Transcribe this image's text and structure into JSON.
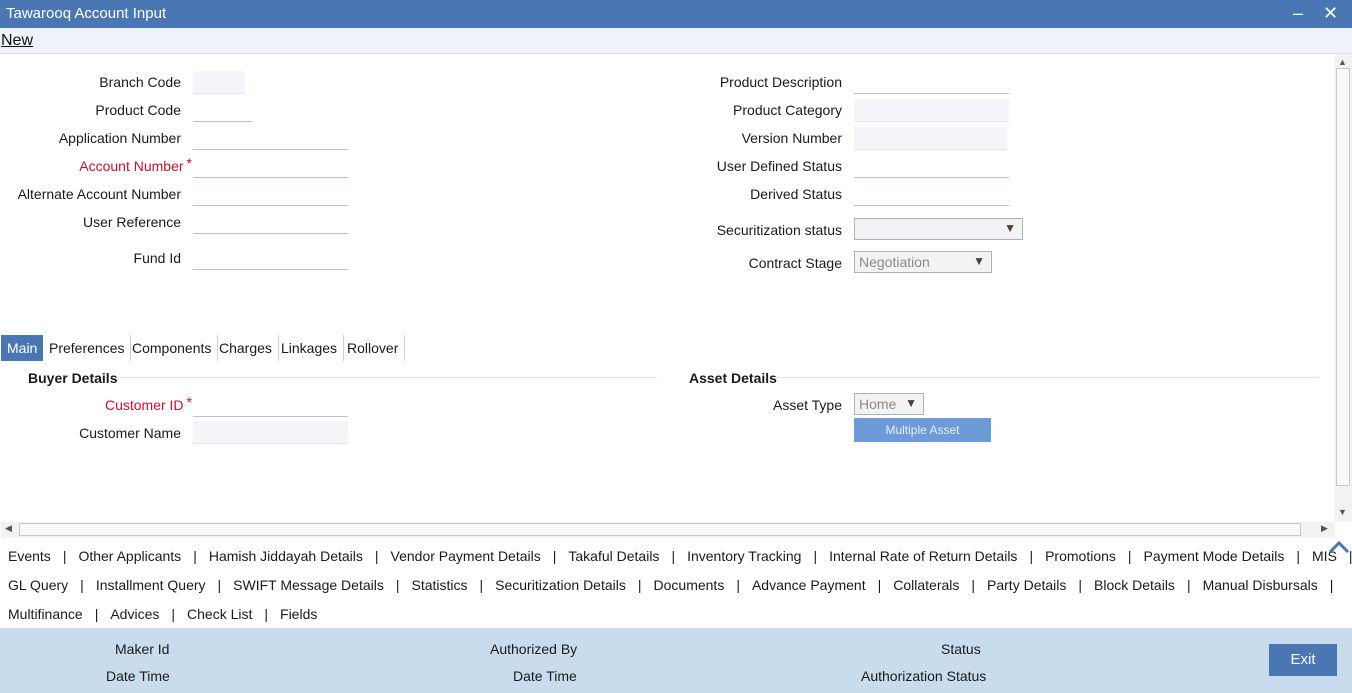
{
  "window": {
    "title": "Tawarooq Account Input",
    "minimize": "–",
    "close": "✕"
  },
  "menu": {
    "new": "New"
  },
  "form": {
    "branch_code": "Branch Code",
    "product_code": "Product Code",
    "application_number": "Application Number",
    "account_number": "Account Number",
    "alternate_account_number": "Alternate Account Number",
    "user_reference": "User Reference",
    "fund_id": "Fund Id",
    "product_description": "Product Description",
    "product_category": "Product Category",
    "version_number": "Version Number",
    "user_defined_status": "User Defined Status",
    "derived_status": "Derived Status",
    "securitization_status": "Securitization status",
    "securitization_status_value": "",
    "contract_stage": "Contract Stage",
    "contract_stage_value": "Negotiation",
    "required_mark": "*"
  },
  "tabs": [
    "Main",
    "Preferences",
    "Components",
    "Charges",
    "Linkages",
    "Rollover"
  ],
  "main": {
    "buyer_details": "Buyer Details",
    "customer_id": "Customer ID",
    "customer_name": "Customer Name",
    "asset_details": "Asset Details",
    "asset_type": "Asset Type",
    "asset_type_value": "Home",
    "multiple_asset": "Multiple Asset"
  },
  "links": {
    "row1": [
      "Events",
      "Other Applicants",
      "Hamish Jiddayah Details",
      "Vendor Payment Details",
      "Takaful Details",
      "Inventory Tracking",
      "Internal Rate of Return Details",
      "Promotions",
      "Payment Mode Details",
      "MIS"
    ],
    "row2": [
      "GL Query",
      "Installment Query",
      "SWIFT Message Details",
      "Statistics",
      "Securitization Details",
      "Documents",
      "Advance Payment",
      "Collaterals",
      "Party Details",
      "Block Details",
      "Manual Disbursals"
    ],
    "row3": [
      "Multifinance",
      "Advices",
      "Check List",
      "Fields"
    ],
    "separator": "|"
  },
  "footer": {
    "maker_id": "Maker Id",
    "date_time": "Date Time",
    "authorized_by": "Authorized By",
    "date_time_2": "Date Time",
    "status": "Status",
    "authorization_status": "Authorization Status",
    "exit": "Exit"
  },
  "colors": {
    "header": "#4a77b3",
    "footer": "#c9dcee",
    "required": "#c8102e",
    "button": "#6d9bd8"
  }
}
